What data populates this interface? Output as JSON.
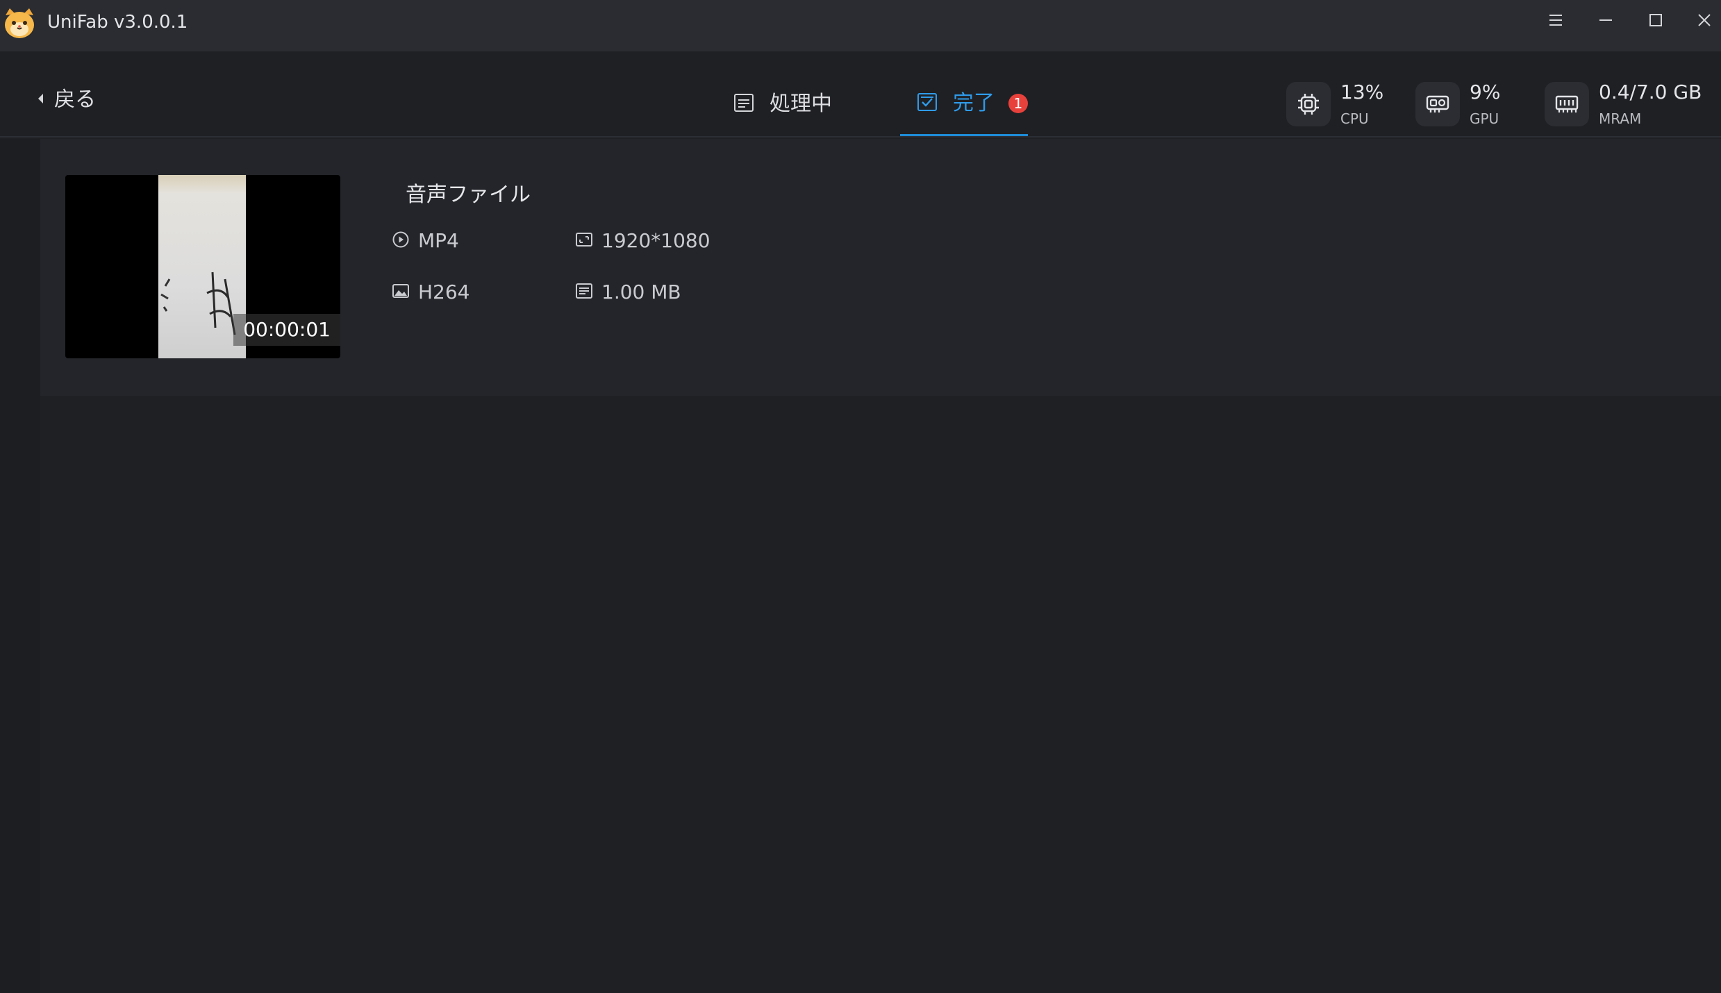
{
  "app": {
    "title": "UniFab v3.0.0.1"
  },
  "toolbar": {
    "back_label": "戻る",
    "tabs": [
      {
        "label": "処理中",
        "active": false
      },
      {
        "label": "完了",
        "active": true,
        "badge": "1"
      }
    ]
  },
  "stats": {
    "cpu": {
      "value": "13%",
      "label": "CPU"
    },
    "gpu": {
      "value": "9%",
      "label": "GPU"
    },
    "mram": {
      "value": "0.4/7.0 GB",
      "label": "MRAM"
    }
  },
  "file": {
    "name": "音声ファイル",
    "duration": "00:00:01",
    "format": "MP4",
    "resolution": "1920*1080",
    "codec": "H264",
    "size": "1.00 MB"
  },
  "colors": {
    "accent": "#2f9bea",
    "badge": "#e8413c",
    "background": "#1f2024",
    "titlebar": "#2a2c31"
  },
  "icons": {
    "logo": "cat-logo-icon",
    "menu": "hamburger-menu-icon",
    "minimize": "minimize-icon",
    "maximize": "maximize-icon",
    "close": "close-icon",
    "back": "chevron-left-icon",
    "processing": "list-document-icon",
    "done": "checkbox-icon",
    "cpu": "cpu-chip-icon",
    "gpu": "gpu-card-icon",
    "mram": "memory-icon",
    "format": "play-circle-icon",
    "resolution": "resolution-icon",
    "codec": "image-icon",
    "size": "file-size-icon"
  }
}
